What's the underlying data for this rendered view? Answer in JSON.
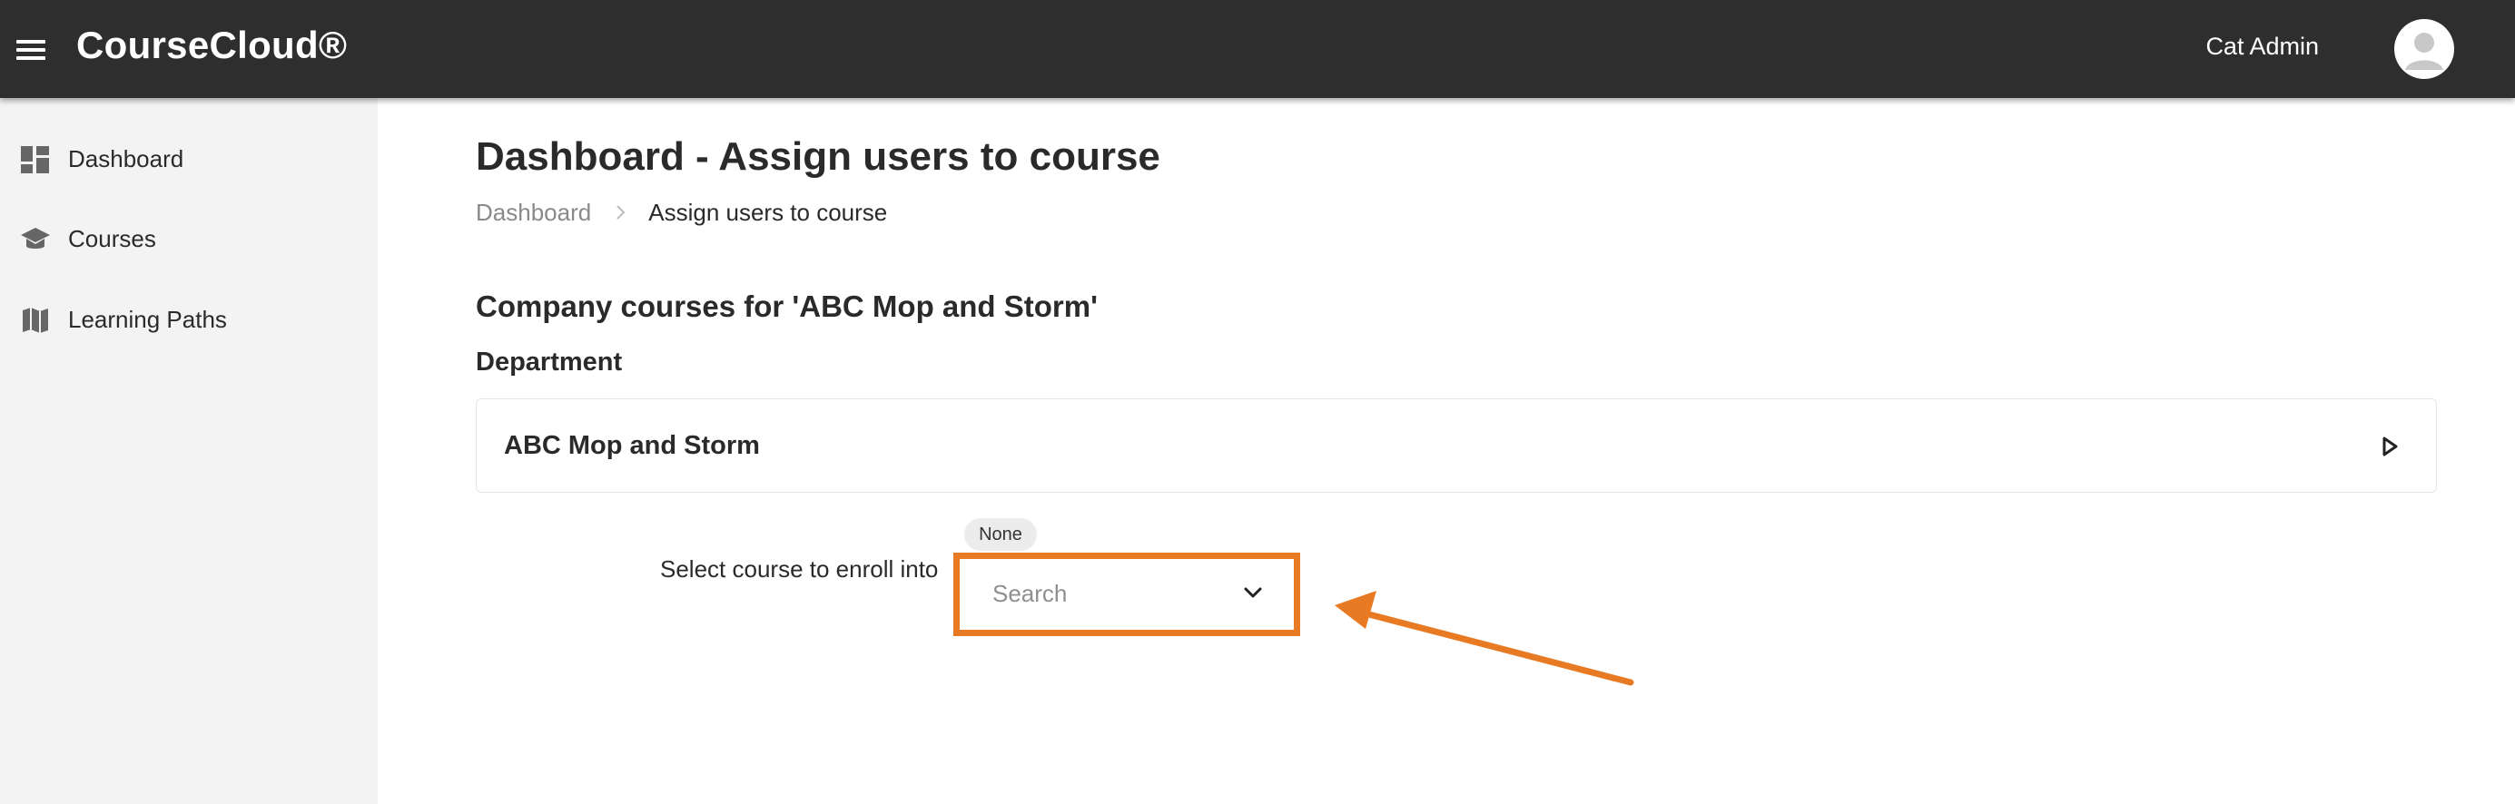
{
  "header": {
    "brand": "CourseCloud®",
    "user_name": "Cat Admin"
  },
  "sidebar": {
    "items": [
      {
        "label": "Dashboard",
        "icon": "dashboard-icon"
      },
      {
        "label": "Courses",
        "icon": "school-icon"
      },
      {
        "label": "Learning Paths",
        "icon": "map-icon"
      }
    ]
  },
  "main": {
    "title": "Dashboard - Assign users to course",
    "breadcrumb": {
      "root": "Dashboard",
      "current": "Assign users to course"
    },
    "section_title": "Company courses for 'ABC Mop and Storm'",
    "department_label": "Department",
    "department_name": "ABC Mop and Storm",
    "enroll_label": "Select course to enroll into",
    "course_select": {
      "selected": "None",
      "value": "",
      "placeholder": "Search"
    }
  },
  "colors": {
    "topbar": "#2e2e2e",
    "sidebar": "#f3f3f3",
    "highlight": "#e87a24"
  }
}
